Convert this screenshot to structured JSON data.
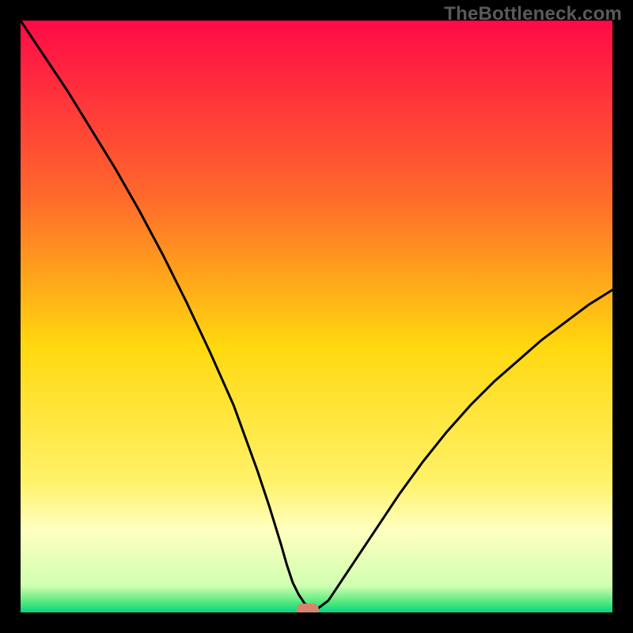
{
  "watermark": "TheBottleneck.com",
  "chart_data": {
    "type": "line",
    "title": "",
    "xlabel": "",
    "ylabel": "",
    "xlim": [
      0,
      100
    ],
    "ylim": [
      0,
      100
    ],
    "series": [
      {
        "name": "curve",
        "x": [
          0,
          4,
          8,
          12,
          16,
          20,
          24,
          28,
          32,
          36,
          40,
          42,
          44,
          45,
          46,
          47,
          48,
          49,
          50,
          52,
          56,
          60,
          64,
          68,
          72,
          76,
          80,
          84,
          88,
          92,
          96,
          100
        ],
        "values": [
          100,
          94,
          88,
          81.5,
          75,
          68,
          60.5,
          52.5,
          44,
          35,
          24,
          18,
          11.5,
          8,
          5,
          3,
          1.5,
          0.8,
          0.5,
          2,
          8,
          14,
          20,
          25.5,
          30.5,
          35,
          39,
          42.5,
          46,
          49,
          52,
          54.5
        ]
      }
    ],
    "marker": {
      "x": 48.5,
      "y": 0.5
    },
    "gradient_bands": [
      {
        "y": 0.0,
        "color": "#ff0a47"
      },
      {
        "y": 0.3,
        "color": "#ff6a2b"
      },
      {
        "y": 0.55,
        "color": "#ffd80e"
      },
      {
        "y": 0.78,
        "color": "#fff26a"
      },
      {
        "y": 0.86,
        "color": "#ffffc0"
      },
      {
        "y": 0.955,
        "color": "#d0ffb0"
      },
      {
        "y": 0.985,
        "color": "#4be67a"
      },
      {
        "y": 1.0,
        "color": "#00d48a"
      }
    ]
  }
}
